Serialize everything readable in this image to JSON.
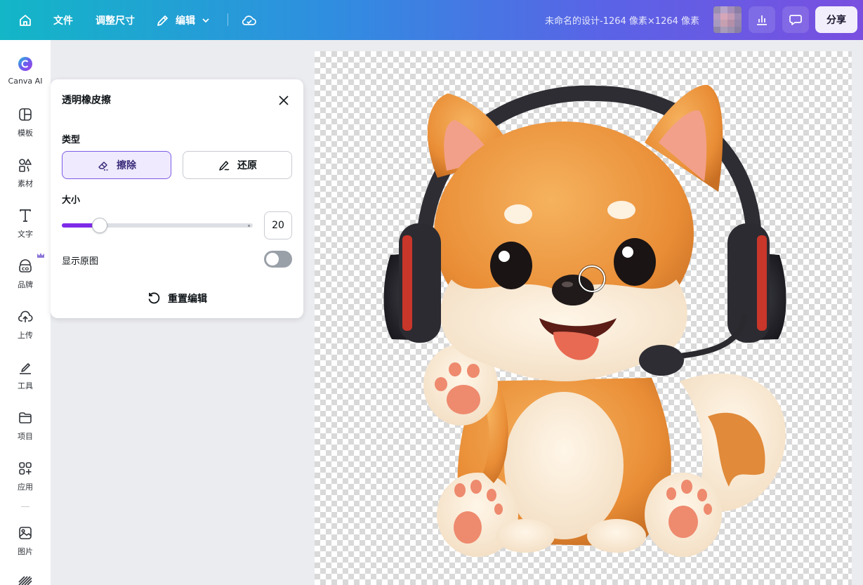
{
  "header": {
    "file_label": "文件",
    "resize_label": "调整尺寸",
    "edit_label": "编辑",
    "doc_title": "未命名的设计-1264 像素×1264 像素",
    "share_label": "分享"
  },
  "rail": {
    "items": [
      {
        "label": "Canva AI",
        "icon": "canva-ai-icon"
      },
      {
        "label": "模板",
        "icon": "templates-icon"
      },
      {
        "label": "素材",
        "icon": "elements-icon"
      },
      {
        "label": "文字",
        "icon": "text-icon"
      },
      {
        "label": "品牌",
        "icon": "brand-icon"
      },
      {
        "label": "上传",
        "icon": "upload-icon"
      },
      {
        "label": "工具",
        "icon": "tools-icon"
      },
      {
        "label": "项目",
        "icon": "folder-icon"
      },
      {
        "label": "应用",
        "icon": "apps-icon"
      },
      {
        "label": "图片",
        "icon": "image-icon"
      }
    ]
  },
  "panel": {
    "title": "透明橡皮擦",
    "type_label": "类型",
    "erase_label": "擦除",
    "restore_label": "还原",
    "size_label": "大小",
    "size_value": "20",
    "size_fraction": 0.2,
    "show_original_label": "显示原图",
    "show_original_on": false,
    "reset_label": "重置编辑"
  },
  "colors": {
    "accent": "#7d2ae8",
    "header_start": "#13b6c7",
    "header_end": "#7a4fe0"
  }
}
